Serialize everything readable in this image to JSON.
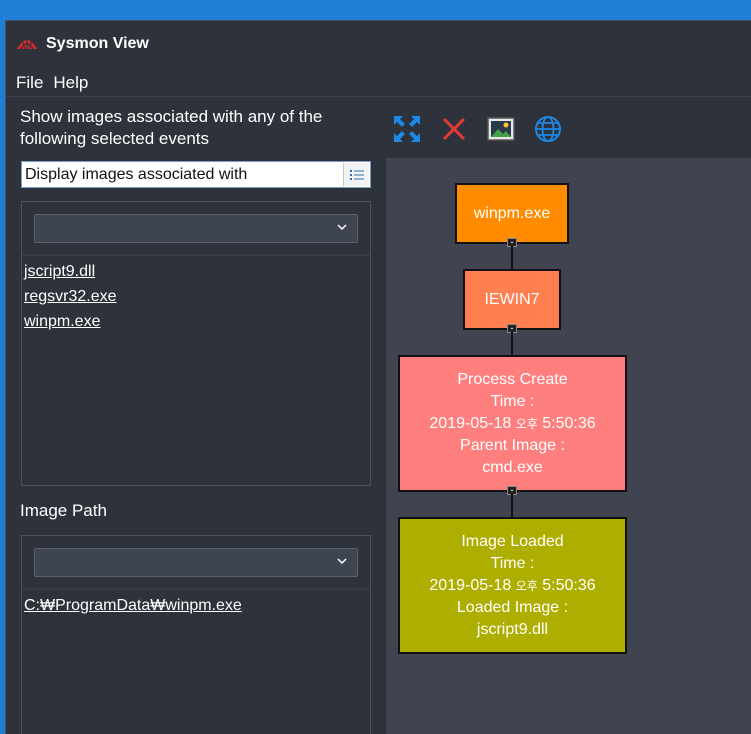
{
  "window": {
    "title": "Sysmon View",
    "brand_color": "#d62b2b"
  },
  "menu": {
    "items": [
      "File",
      "Help"
    ]
  },
  "left": {
    "description": "Show images associated with any of the following selected events",
    "mode_select": {
      "value": "Display images associated with",
      "icon": "list-icon"
    },
    "events_links": [
      "jscript9.dll",
      "regsvr32.exe",
      "winpm.exe"
    ],
    "image_path_label": "Image Path",
    "image_path_links": [
      "C:₩ProgramData₩winpm.exe"
    ]
  },
  "toolbar": {
    "buttons": [
      {
        "name": "expand-icon",
        "color": "#1e88e5"
      },
      {
        "name": "close-icon",
        "color": "#e53935"
      },
      {
        "name": "image-icon",
        "color": "#43a047"
      },
      {
        "name": "globe-icon",
        "color": "#1e88e5"
      }
    ]
  },
  "graph": {
    "nodes": [
      {
        "id": "winpm",
        "lines": [
          "winpm.exe"
        ],
        "color": "#ff8c00"
      },
      {
        "id": "iewin7",
        "lines": [
          "IEWIN7"
        ],
        "color": "#ff7f50"
      },
      {
        "id": "process",
        "lines": [
          "Process Create",
          "Time :",
          "2019-05-18 오후 5:50:36",
          "Parent Image :",
          "cmd.exe"
        ],
        "color": "#ff7f7f"
      },
      {
        "id": "image",
        "lines": [
          "Image Loaded",
          "Time :",
          "2019-05-18 오후 5:50:36",
          "Loaded Image :",
          "jscript9.dll"
        ],
        "color": "#adae00"
      }
    ],
    "collapse_glyph": "-"
  }
}
